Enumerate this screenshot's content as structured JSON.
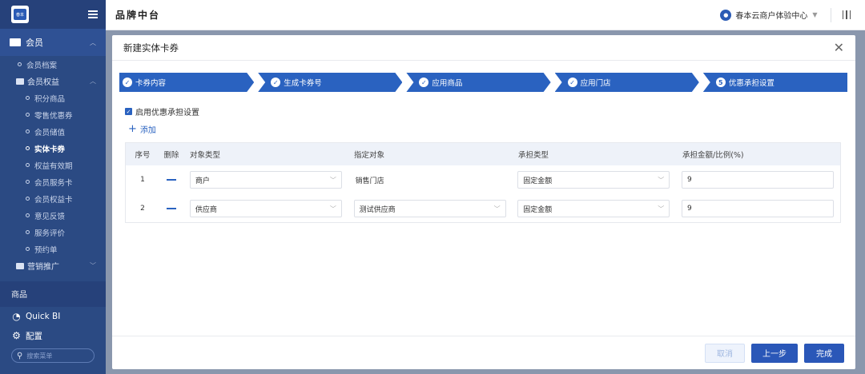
{
  "sidebar": {
    "logo_text": "春本",
    "member_group": "会员",
    "member_archive": "会员档案",
    "member_rights": "会员权益",
    "rights_items": [
      {
        "label": "积分商品",
        "active": false
      },
      {
        "label": "零售优惠券",
        "active": false
      },
      {
        "label": "会员储值",
        "active": false
      },
      {
        "label": "实体卡券",
        "active": true
      },
      {
        "label": "权益有效期",
        "active": false
      },
      {
        "label": "会员服务卡",
        "active": false
      },
      {
        "label": "会员权益卡",
        "active": false
      },
      {
        "label": "意见反馈",
        "active": false
      },
      {
        "label": "服务评价",
        "active": false
      },
      {
        "label": "预约单",
        "active": false
      }
    ],
    "marketing": "营销推广",
    "cut_label": "商品",
    "quick_bi": "Quick BI",
    "config": "配置",
    "search_placeholder": "搜索菜单"
  },
  "topbar": {
    "brand": "品牌中台",
    "org": "春本云商户体验中心"
  },
  "modal": {
    "title": "新建实体卡券",
    "steps": [
      {
        "icon": "✓",
        "label": "卡券内容"
      },
      {
        "icon": "✓",
        "label": "生成卡券号"
      },
      {
        "icon": "✓",
        "label": "应用商品"
      },
      {
        "icon": "✓",
        "label": "应用门店"
      },
      {
        "icon": "5",
        "label": "优惠承担设置"
      }
    ],
    "enable_label": "启用优惠承担设置",
    "add_label": "添加",
    "headers": {
      "no": "序号",
      "del": "删除",
      "type": "对象类型",
      "target": "指定对象",
      "bear": "承担类型",
      "amount": "承担金额/比例(%)"
    },
    "rows": [
      {
        "no": "1",
        "type": "商户",
        "target": "销售门店",
        "bear": "固定金额",
        "amount": "9"
      },
      {
        "no": "2",
        "type": "供应商",
        "target": "测试供应商",
        "bear": "固定金额",
        "amount": "9"
      }
    ],
    "buttons": {
      "cancel": "取消",
      "prev": "上一步",
      "done": "完成"
    }
  }
}
